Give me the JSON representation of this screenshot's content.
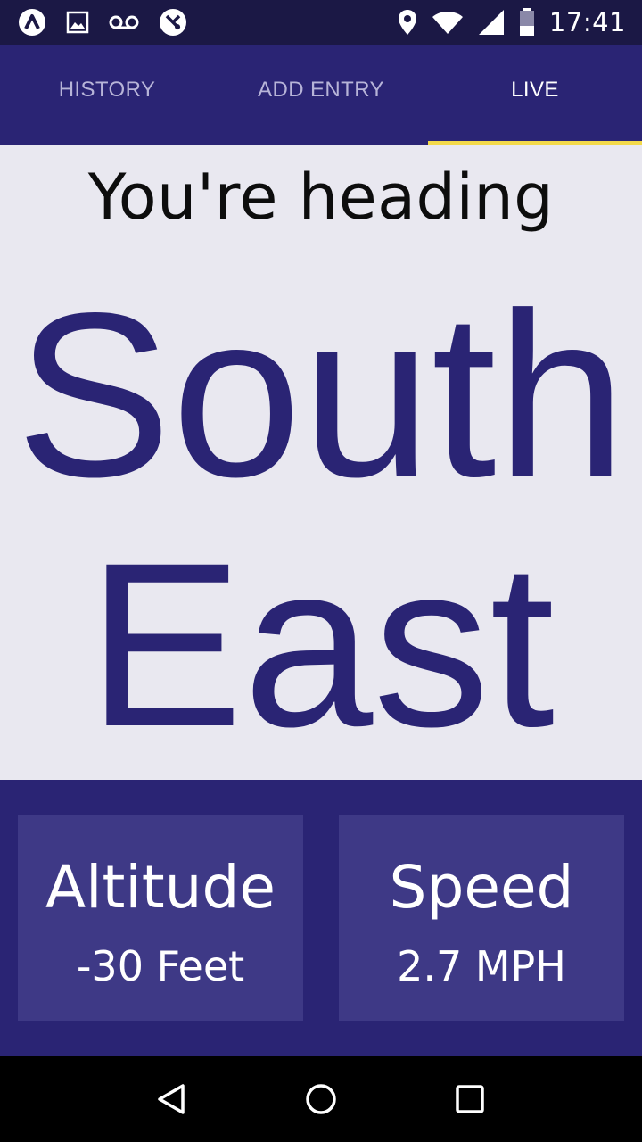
{
  "status_bar": {
    "time": "17:41",
    "left_icons": [
      "app-logo-icon",
      "image-icon",
      "voicemail-icon",
      "no-sim-icon"
    ],
    "right_icons": [
      "location-icon",
      "wifi-icon",
      "signal-icon",
      "battery-icon"
    ]
  },
  "tabs": [
    {
      "label": "HISTORY",
      "active": false
    },
    {
      "label": "ADD ENTRY",
      "active": false
    },
    {
      "label": "LIVE",
      "active": true
    }
  ],
  "main": {
    "heading_label": "You're heading",
    "direction_line1": "South",
    "direction_line2": "East"
  },
  "stats": {
    "altitude": {
      "title": "Altitude",
      "value": "-30 Feet"
    },
    "speed": {
      "title": "Speed",
      "value": "2.7 MPH"
    }
  },
  "nav_bar": {
    "buttons": [
      "back-icon",
      "home-icon",
      "recents-icon"
    ]
  },
  "colors": {
    "primary": "#2a2474",
    "card": "#3e3986",
    "indicator": "#f3d94a",
    "background": "#e9e8f0"
  }
}
